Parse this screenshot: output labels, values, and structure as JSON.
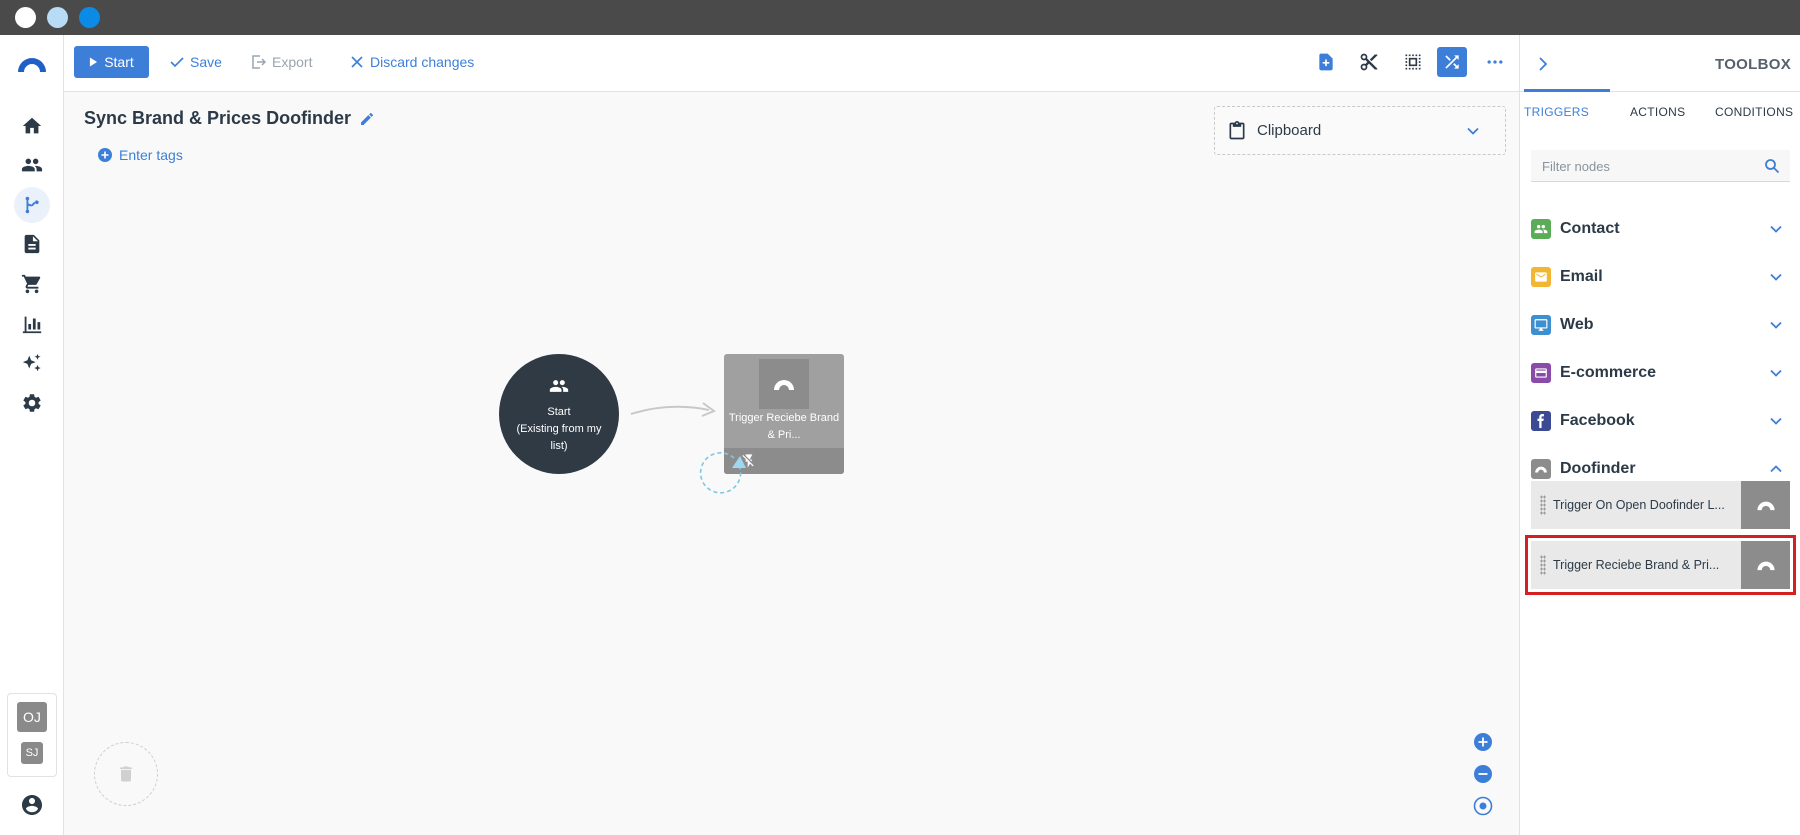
{
  "app": {
    "accent_color": "#3d7fd8"
  },
  "toolbar": {
    "start_label": "Start",
    "save_label": "Save",
    "export_label": "Export",
    "discard_label": "Discard changes"
  },
  "workflow": {
    "title": "Sync Brand & Prices Doofinder",
    "tags_label": "Enter tags"
  },
  "clipboard": {
    "label": "Clipboard"
  },
  "nodes": {
    "start": {
      "line1": "Start",
      "line2": "(Existing from my",
      "line3": "list)"
    },
    "trigger": {
      "label": "Trigger Reciebe Brand & Pri..."
    }
  },
  "sidebar": {
    "items": [
      {
        "name": "home-icon",
        "active": false
      },
      {
        "name": "contacts-icon",
        "active": false
      },
      {
        "name": "workflows-icon",
        "active": true
      },
      {
        "name": "document-icon",
        "active": false
      },
      {
        "name": "cart-icon",
        "active": false
      },
      {
        "name": "chart-icon",
        "active": false
      },
      {
        "name": "sparkle-icon",
        "active": false
      },
      {
        "name": "gear-icon",
        "active": false
      }
    ],
    "avatars": [
      "OJ",
      "SJ"
    ]
  },
  "toolbox": {
    "title": "TOOLBOX",
    "tabs": [
      {
        "label": "TRIGGERS",
        "active": true
      },
      {
        "label": "ACTIONS",
        "active": false
      },
      {
        "label": "CONDITIONS",
        "active": false
      }
    ],
    "filter_placeholder": "Filter nodes",
    "categories": [
      {
        "label": "Contact",
        "color": "#5aac56",
        "expanded": false
      },
      {
        "label": "Email",
        "color": "#f2b632",
        "expanded": false
      },
      {
        "label": "Web",
        "color": "#3e8fd0",
        "expanded": false
      },
      {
        "label": "E-commerce",
        "color": "#8a4aa8",
        "expanded": false
      },
      {
        "label": "Facebook",
        "color": "#3b4a93",
        "expanded": false
      },
      {
        "label": "Doofinder",
        "color": "#8c8c8c",
        "expanded": true
      }
    ],
    "doofinder_items": [
      {
        "label": "Trigger On Open Doofinder L..."
      },
      {
        "label": "Trigger Reciebe Brand & Pri..."
      }
    ]
  }
}
